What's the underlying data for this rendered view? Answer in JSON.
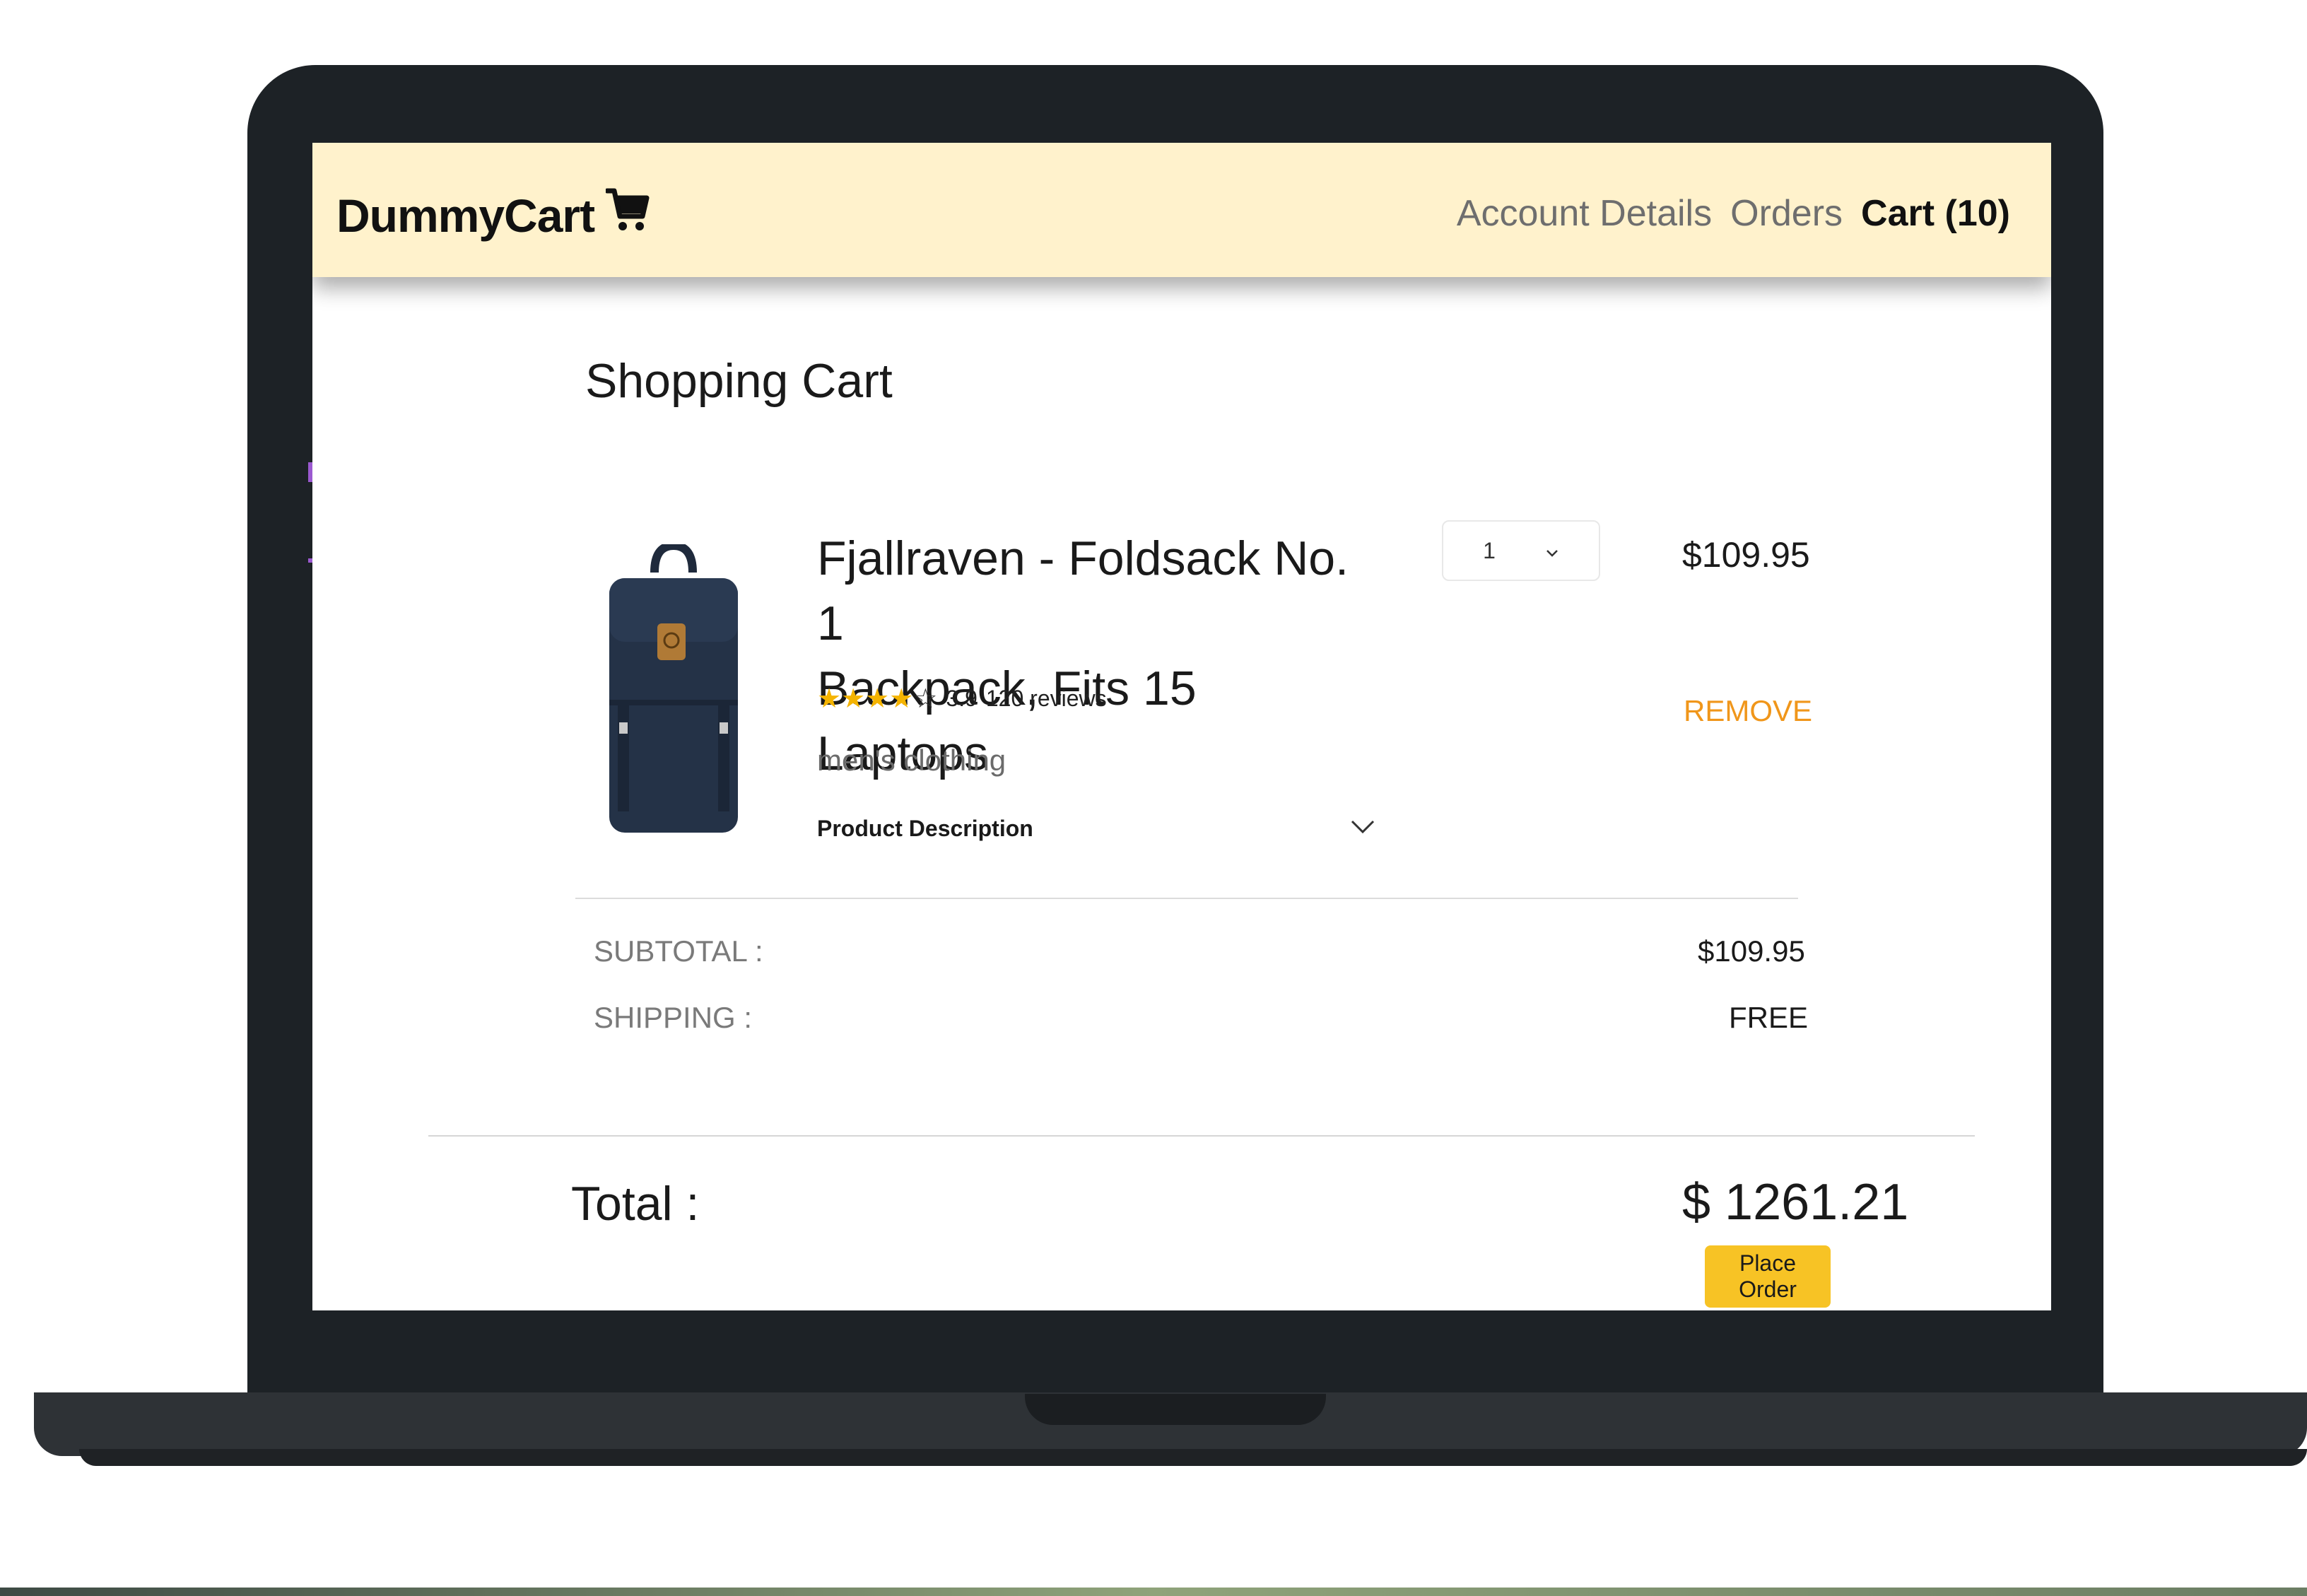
{
  "header": {
    "brand": "DummyCart",
    "brand_icon": "shopping-cart-icon",
    "nav": {
      "account": "Account Details",
      "orders": "Orders",
      "cart": "Cart (10)"
    }
  },
  "page": {
    "title": "Shopping Cart"
  },
  "cart_item": {
    "name_line1": "Fjallraven - Foldsack No. 1",
    "name_line2": "Backpack, Fits 15 Laptops",
    "rating_value": "3.9",
    "rating_stars": 3.9,
    "reviews": "120 reviews",
    "category": "men's clothing",
    "description_label": "Product Description",
    "quantity": "1",
    "price": "$109.95",
    "remove_label": "REMOVE"
  },
  "summary": {
    "subtotal_label": "SUBTOTAL :",
    "subtotal_value": "$109.95",
    "shipping_label": "SHIPPING :",
    "shipping_value": "FREE",
    "total_label": "Total :",
    "total_value": "$ 1261.21",
    "place_order_label": "Place Order"
  },
  "colors": {
    "navbar_bg": "#fff2cc",
    "accent_orange": "#f0961a",
    "button_yellow": "#f7c325",
    "star_gold": "#f5b400",
    "laptop_body": "#1d2226"
  }
}
